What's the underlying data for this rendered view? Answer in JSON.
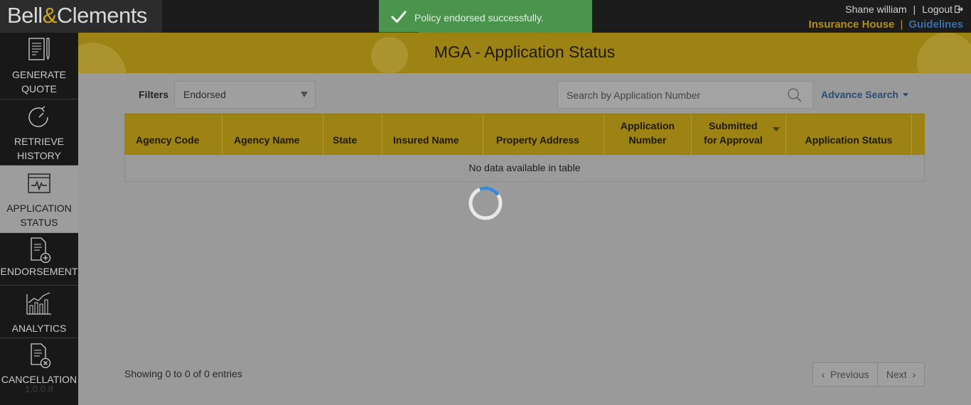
{
  "app": {
    "logo_part1": "Bell",
    "logo_amp": "&",
    "logo_part2": "Clements"
  },
  "user": {
    "name": "Shane william",
    "separator": "|",
    "logout_label": "Logout"
  },
  "top_links": {
    "insurance_house": "Insurance House",
    "separator": "|",
    "guidelines": "Guidelines"
  },
  "toast": {
    "message": "Policy endorsed successfully.",
    "icon": "check-icon"
  },
  "sidebar": {
    "items": [
      {
        "line1": "GENERATE",
        "line2": "QUOTE",
        "icon": "document-pencil-icon",
        "active": false
      },
      {
        "line1": "RETRIEVE",
        "line2": "HISTORY",
        "icon": "history-clock-icon",
        "active": false
      },
      {
        "line1": "APPLICATION",
        "line2": "STATUS",
        "icon": "monitor-pulse-icon",
        "active": true
      },
      {
        "line1": "ENDORSEMENT",
        "line2": "",
        "icon": "document-plus-icon",
        "active": false
      },
      {
        "line1": "ANALYTICS",
        "line2": "",
        "icon": "bar-chart-trend-icon",
        "active": false
      },
      {
        "line1": "CANCELLATION",
        "line2": "",
        "icon": "document-cancel-icon",
        "active": false
      }
    ],
    "version": "1.0.0.8"
  },
  "page": {
    "title": "MGA - Application Status"
  },
  "filters": {
    "label": "Filters",
    "selected": "Endorsed"
  },
  "search": {
    "placeholder": "Search by Application Number",
    "advance_label": "Advance Search"
  },
  "table": {
    "columns": [
      {
        "line1": "Agency Code",
        "line2": ""
      },
      {
        "line1": "Agency Name",
        "line2": ""
      },
      {
        "line1": "State",
        "line2": ""
      },
      {
        "line1": "Insured Name",
        "line2": ""
      },
      {
        "line1": "Property Address",
        "line2": ""
      },
      {
        "line1": "Application",
        "line2": "Number"
      },
      {
        "line1": "Submitted",
        "line2": "for Approval"
      },
      {
        "line1": "Application Status",
        "line2": ""
      }
    ],
    "empty_message": "No data available in table"
  },
  "footer": {
    "showing": "Showing 0 to 0 of 0 entries",
    "previous": "Previous",
    "next": "Next"
  },
  "colors": {
    "accent_gold": "#b58f17",
    "link_blue": "#3a6fa6",
    "toast_green": "#4a944d",
    "spinner_blue": "#3a8ad6"
  }
}
